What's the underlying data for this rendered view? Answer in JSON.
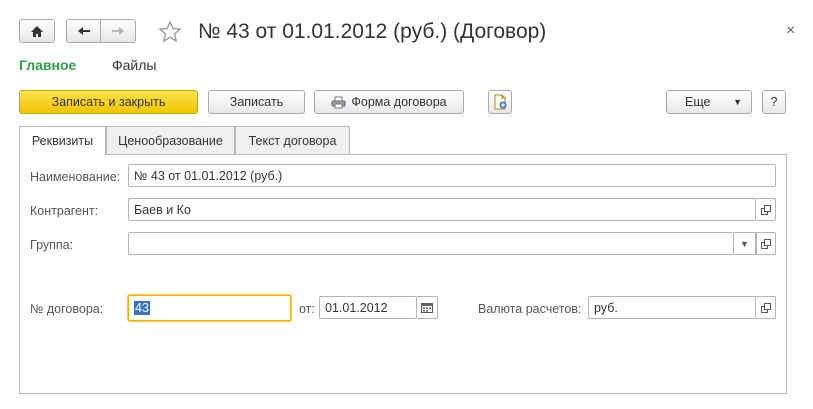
{
  "window": {
    "title": "№ 43 от 01.01.2012 (руб.) (Договор)",
    "close_glyph": "×",
    "star_glyph": "☆"
  },
  "section_nav": {
    "main_label": "Главное",
    "files_label": "Файлы"
  },
  "toolbar": {
    "save_close_label": "Записать и закрыть",
    "save_label": "Записать",
    "contract_form_label": "Форма договора",
    "more_label": "Еще",
    "help_label": "?"
  },
  "tabs": [
    {
      "label": "Реквизиты",
      "active": true
    },
    {
      "label": "Ценообразование",
      "active": false
    },
    {
      "label": "Текст договора",
      "active": false
    }
  ],
  "form": {
    "name_label": "Наименование:",
    "name_value": "№ 43 от 01.01.2012 (руб.)",
    "contractor_label": "Контрагент:",
    "contractor_value": "Баев и Ко",
    "group_label": "Группа:",
    "group_value": "",
    "number_label": "№ договора:",
    "number_value": "43",
    "date_label": "от:",
    "date_value": "01.01.2012",
    "currency_label": "Валюта расчетов:",
    "currency_value": "руб."
  },
  "colors": {
    "accent_green": "#2e9e4e",
    "primary_button": "#f5d21f",
    "focus_border": "#f0b400",
    "selection": "#3a73c6"
  }
}
